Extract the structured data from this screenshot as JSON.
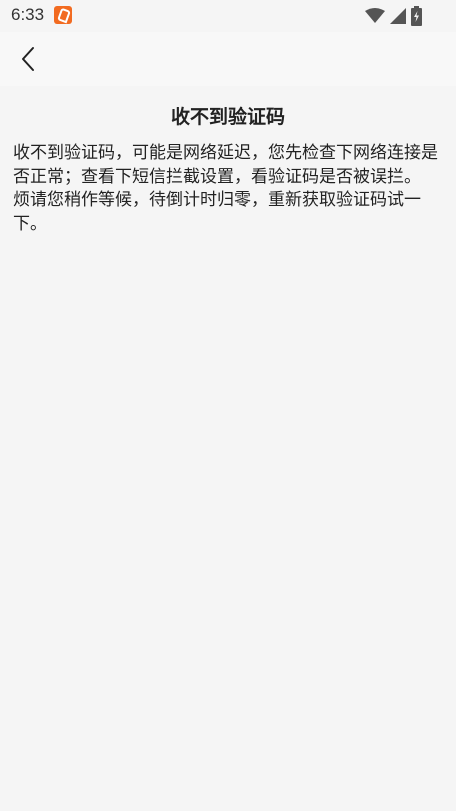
{
  "status_bar": {
    "time": "6:33",
    "app_icon": "app-notification-icon",
    "icons": [
      "wifi-icon",
      "signal-icon",
      "battery-charging-icon"
    ]
  },
  "nav": {
    "back_icon": "chevron-left-icon"
  },
  "page": {
    "title": "收不到验证码",
    "paragraph_1": "收不到验证码，可能是网络延迟，您先检查下网络连接是否正常；查看下短信拦截设置，看验证码是否被误拦。",
    "paragraph_2": "烦请您稍作等候，待倒计时归零，重新获取验证码试一下。"
  },
  "colors": {
    "background": "#f5f5f5",
    "app_icon": "#f26b21",
    "text": "#222222"
  }
}
